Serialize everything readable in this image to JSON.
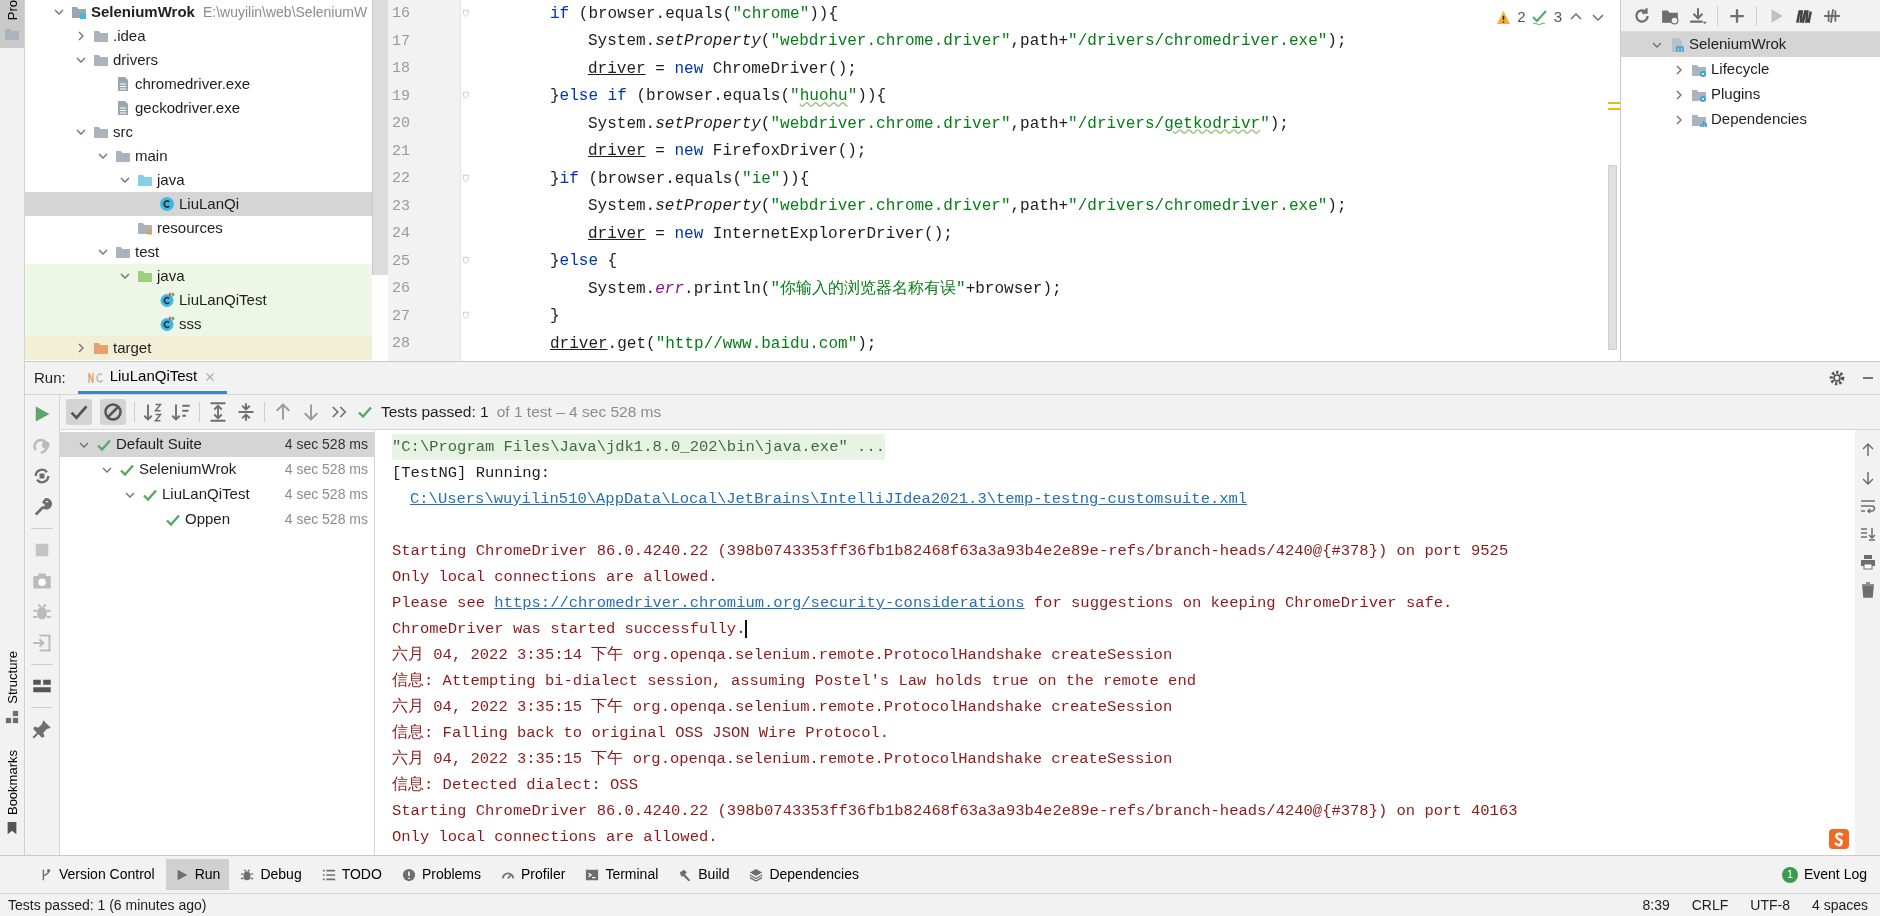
{
  "tool_stripe": {
    "top": [
      {
        "label": "Pro",
        "selected": true
      }
    ],
    "bottom": [
      {
        "label": "Structure",
        "selected": false
      },
      {
        "label": "Bookmarks",
        "selected": false
      }
    ]
  },
  "project": {
    "tree": [
      {
        "label": "SeleniumWrok",
        "hint": "E:\\wuyilin\\web\\SeleniumW",
        "kind": "module",
        "expanded": true,
        "selected": false,
        "children": [
          {
            "label": ".idea",
            "kind": "folder",
            "expanded": false,
            "selected": false
          },
          {
            "label": "drivers",
            "kind": "folder",
            "expanded": true,
            "selected": false,
            "children": [
              {
                "label": "chromedriver.exe",
                "kind": "file",
                "selected": false
              },
              {
                "label": "geckodriver.exe",
                "kind": "file",
                "selected": false
              }
            ]
          },
          {
            "label": "src",
            "kind": "folder",
            "expanded": true,
            "selected": false,
            "children": [
              {
                "label": "main",
                "kind": "folder",
                "expanded": true,
                "selected": false,
                "children": [
                  {
                    "label": "java",
                    "kind": "source",
                    "expanded": true,
                    "selected": false,
                    "children": [
                      {
                        "label": "LiuLanQi",
                        "kind": "class",
                        "selected": true
                      }
                    ]
                  },
                  {
                    "label": "resources",
                    "kind": "resources",
                    "selected": false
                  }
                ]
              },
              {
                "label": "test",
                "kind": "folder",
                "expanded": true,
                "selected": false,
                "children": [
                  {
                    "label": "java",
                    "kind": "test-source",
                    "expanded": true,
                    "selected": false,
                    "children": [
                      {
                        "label": "LiuLanQiTest",
                        "kind": "test-class",
                        "selected": false
                      },
                      {
                        "label": "sss",
                        "kind": "test-class",
                        "selected": false
                      }
                    ]
                  }
                ]
              }
            ]
          },
          {
            "label": "target",
            "kind": "excluded",
            "expanded": false,
            "selected": false
          }
        ]
      }
    ]
  },
  "editor": {
    "warnings": "2",
    "weak_warnings": "3",
    "lines": [
      {
        "number": "16",
        "fold": true,
        "kind": "outer",
        "tokens": [
          {
            "kind": "kw",
            "text": "if"
          },
          {
            "kind": "plain",
            "text": " (browser.equals("
          },
          {
            "kind": "str",
            "text": "\"chrome\""
          },
          {
            "kind": "plain",
            "text": ")){"
          }
        ]
      },
      {
        "number": "17",
        "fold": false,
        "kind": "inner",
        "tokens": [
          {
            "kind": "plain",
            "text": "System."
          },
          {
            "kind": "italic",
            "text": "setProperty"
          },
          {
            "kind": "plain",
            "text": "("
          },
          {
            "kind": "str",
            "text": "\"webdriver.chrome.driver\""
          },
          {
            "kind": "plain",
            "text": ",path+"
          },
          {
            "kind": "str",
            "text": "\"/drivers/chromedriver.exe\""
          },
          {
            "kind": "plain",
            "text": ");"
          }
        ]
      },
      {
        "number": "18",
        "fold": false,
        "kind": "inner",
        "tokens": [
          {
            "kind": "field",
            "text": "driver"
          },
          {
            "kind": "plain",
            "text": " = "
          },
          {
            "kind": "kw",
            "text": "new"
          },
          {
            "kind": "plain",
            "text": " ChromeDriver();"
          }
        ]
      },
      {
        "number": "19",
        "fold": true,
        "kind": "outer",
        "tokens": [
          {
            "kind": "plain",
            "text": "}"
          },
          {
            "kind": "kw",
            "text": "else if"
          },
          {
            "kind": "plain",
            "text": " (browser.equals("
          },
          {
            "kind": "str",
            "text": "\""
          },
          {
            "kind": "typo",
            "text": "huohu"
          },
          {
            "kind": "str",
            "text": "\""
          },
          {
            "kind": "plain",
            "text": ")){"
          }
        ]
      },
      {
        "number": "20",
        "fold": false,
        "kind": "inner",
        "tokens": [
          {
            "kind": "plain",
            "text": "System."
          },
          {
            "kind": "italic",
            "text": "setProperty"
          },
          {
            "kind": "plain",
            "text": "("
          },
          {
            "kind": "str",
            "text": "\"webdriver.chrome.driver\""
          },
          {
            "kind": "plain",
            "text": ",path+"
          },
          {
            "kind": "str",
            "text": "\"/drivers/"
          },
          {
            "kind": "typo",
            "text": "getkodrivr"
          },
          {
            "kind": "str",
            "text": "\""
          },
          {
            "kind": "plain",
            "text": ");"
          }
        ]
      },
      {
        "number": "21",
        "fold": false,
        "kind": "inner",
        "tokens": [
          {
            "kind": "field",
            "text": "driver"
          },
          {
            "kind": "plain",
            "text": " = "
          },
          {
            "kind": "kw",
            "text": "new"
          },
          {
            "kind": "plain",
            "text": " FirefoxDriver();"
          }
        ]
      },
      {
        "number": "22",
        "fold": true,
        "kind": "outer",
        "tokens": [
          {
            "kind": "plain",
            "text": "}"
          },
          {
            "kind": "kw",
            "text": "if"
          },
          {
            "kind": "plain",
            "text": " (browser.equals("
          },
          {
            "kind": "str",
            "text": "\"ie\""
          },
          {
            "kind": "plain",
            "text": ")){"
          }
        ]
      },
      {
        "number": "23",
        "fold": false,
        "kind": "inner",
        "tokens": [
          {
            "kind": "plain",
            "text": "System."
          },
          {
            "kind": "italic",
            "text": "setProperty"
          },
          {
            "kind": "plain",
            "text": "("
          },
          {
            "kind": "str",
            "text": "\"webdriver.chrome.driver\""
          },
          {
            "kind": "plain",
            "text": ",path+"
          },
          {
            "kind": "str",
            "text": "\"/drivers/chromedriver.exe\""
          },
          {
            "kind": "plain",
            "text": ");"
          }
        ]
      },
      {
        "number": "24",
        "fold": false,
        "kind": "inner",
        "tokens": [
          {
            "kind": "field",
            "text": "driver"
          },
          {
            "kind": "plain",
            "text": " = "
          },
          {
            "kind": "kw",
            "text": "new"
          },
          {
            "kind": "plain",
            "text": " InternetExplorerDriver();"
          }
        ]
      },
      {
        "number": "25",
        "fold": true,
        "kind": "outer",
        "tokens": [
          {
            "kind": "plain",
            "text": "}"
          },
          {
            "kind": "kw",
            "text": "else"
          },
          {
            "kind": "plain",
            "text": " {"
          }
        ]
      },
      {
        "number": "26",
        "fold": false,
        "kind": "inner",
        "tokens": [
          {
            "kind": "plain",
            "text": "System."
          },
          {
            "kind": "static",
            "text": "err"
          },
          {
            "kind": "plain",
            "text": ".println("
          },
          {
            "kind": "str",
            "text": "\"你输入的浏览器名称有误\""
          },
          {
            "kind": "plain",
            "text": "+browser);"
          }
        ]
      },
      {
        "number": "27",
        "fold": true,
        "kind": "outer",
        "tokens": [
          {
            "kind": "plain",
            "text": "}"
          }
        ]
      },
      {
        "number": "28",
        "fold": false,
        "kind": "outer",
        "tokens": [
          {
            "kind": "field",
            "text": "driver"
          },
          {
            "kind": "plain",
            "text": ".get("
          },
          {
            "kind": "str",
            "text": "\"http//www.baidu.com\""
          },
          {
            "kind": "plain",
            "text": ");"
          }
        ]
      }
    ]
  },
  "maven": {
    "tree": [
      {
        "label": "SeleniumWrok",
        "kind": "module",
        "expanded": true,
        "selected": true,
        "children": [
          {
            "label": "Lifecycle",
            "kind": "gear-folder",
            "expanded": false,
            "selected": false
          },
          {
            "label": "Plugins",
            "kind": "gear-folder",
            "expanded": false,
            "selected": false
          },
          {
            "label": "Dependencies",
            "kind": "dependencies",
            "expanded": false,
            "selected": false
          }
        ]
      }
    ]
  },
  "run": {
    "label": "Run:",
    "tabs": [
      {
        "label": "LiuLanQiTest",
        "selected": true
      }
    ],
    "filters": [
      {
        "kind": "passed",
        "selected": true
      },
      {
        "kind": "ignored",
        "selected": true
      }
    ],
    "summary": {
      "status": "Tests passed: 1",
      "detail": "of 1 test – 4 sec 528 ms"
    },
    "tests": [
      {
        "label": "Default Suite",
        "time": "4 sec 528 ms",
        "selected": true,
        "expanded": true,
        "children": [
          {
            "label": "SeleniumWrok",
            "time": "4 sec 528 ms",
            "selected": false,
            "expanded": true,
            "children": [
              {
                "label": "LiuLanQiTest",
                "time": "4 sec 528 ms",
                "selected": false,
                "expanded": true,
                "children": [
                  {
                    "label": "Oppen",
                    "time": "4 sec 528 ms",
                    "selected": false
                  }
                ]
              }
            ]
          }
        ]
      }
    ],
    "console": [
      {
        "kind": "command",
        "parts": [
          {
            "text": "\"C:\\Program Files\\Java\\jdk1.8.0_202\\bin\\java.exe\" ..."
          }
        ]
      },
      {
        "kind": "output",
        "parts": [
          {
            "text": "[TestNG] Running:"
          }
        ]
      },
      {
        "kind": "output",
        "indent": true,
        "parts": [
          {
            "text": "C:\\Users\\wuyilin510\\AppData\\Local\\JetBrains\\IntelliJIdea2021.3\\temp-testng-customsuite.xml",
            "link": true
          }
        ]
      },
      {
        "kind": "blank"
      },
      {
        "kind": "error",
        "parts": [
          {
            "text": "Starting ChromeDriver 86.0.4240.22 (398b0743353ff36fb1b82468f63a3a93b4e2e89e-refs/branch-heads/4240@{#378}) on port 9525"
          }
        ]
      },
      {
        "kind": "error",
        "parts": [
          {
            "text": "Only local connections are allowed."
          }
        ]
      },
      {
        "kind": "error",
        "parts": [
          {
            "text": "Please see "
          },
          {
            "text": "https://chromedriver.chromium.org/security-considerations",
            "link": true
          },
          {
            "text": " for suggestions on keeping ChromeDriver safe."
          }
        ]
      },
      {
        "kind": "error",
        "caret": true,
        "parts": [
          {
            "text": "ChromeDriver was started successfully."
          }
        ]
      },
      {
        "kind": "error",
        "parts": [
          {
            "text": "六月 04, 2022 3:35:14 下午 org.openqa.selenium.remote.ProtocolHandshake createSession"
          }
        ]
      },
      {
        "kind": "error",
        "parts": [
          {
            "text": "信息: Attempting bi-dialect session, assuming Postel's Law holds true on the remote end"
          }
        ]
      },
      {
        "kind": "error",
        "parts": [
          {
            "text": "六月 04, 2022 3:35:15 下午 org.openqa.selenium.remote.ProtocolHandshake createSession"
          }
        ]
      },
      {
        "kind": "error",
        "parts": [
          {
            "text": "信息: Falling back to original OSS JSON Wire Protocol."
          }
        ]
      },
      {
        "kind": "error",
        "parts": [
          {
            "text": "六月 04, 2022 3:35:15 下午 org.openqa.selenium.remote.ProtocolHandshake createSession"
          }
        ]
      },
      {
        "kind": "error",
        "parts": [
          {
            "text": "信息: Detected dialect: OSS"
          }
        ]
      },
      {
        "kind": "error",
        "parts": [
          {
            "text": "Starting ChromeDriver 86.0.4240.22 (398b0743353ff36fb1b82468f63a3a93b4e2e89e-refs/branch-heads/4240@{#378}) on port 40163"
          }
        ]
      },
      {
        "kind": "error",
        "parts": [
          {
            "text": "Only local connections are allowed."
          }
        ]
      }
    ]
  },
  "tool_windows": [
    {
      "label": "Version Control",
      "kind": "branch",
      "selected": false
    },
    {
      "label": "Run",
      "kind": "play",
      "selected": true
    },
    {
      "label": "Debug",
      "kind": "bug",
      "selected": false
    },
    {
      "label": "TODO",
      "kind": "list",
      "selected": false
    },
    {
      "label": "Problems",
      "kind": "alert",
      "selected": false
    },
    {
      "label": "Profiler",
      "kind": "gauge",
      "selected": false
    },
    {
      "label": "Terminal",
      "kind": "terminal",
      "selected": false
    },
    {
      "label": "Build",
      "kind": "hammer",
      "selected": false
    },
    {
      "label": "Dependencies",
      "kind": "stack",
      "selected": false
    }
  ],
  "event_log": {
    "label": "Event Log",
    "count": "1"
  },
  "status_bar": {
    "message": "Tests passed: 1 (6 minutes ago)",
    "items": [
      "8:39",
      "CRLF",
      "UTF-8",
      "4 spaces"
    ]
  }
}
